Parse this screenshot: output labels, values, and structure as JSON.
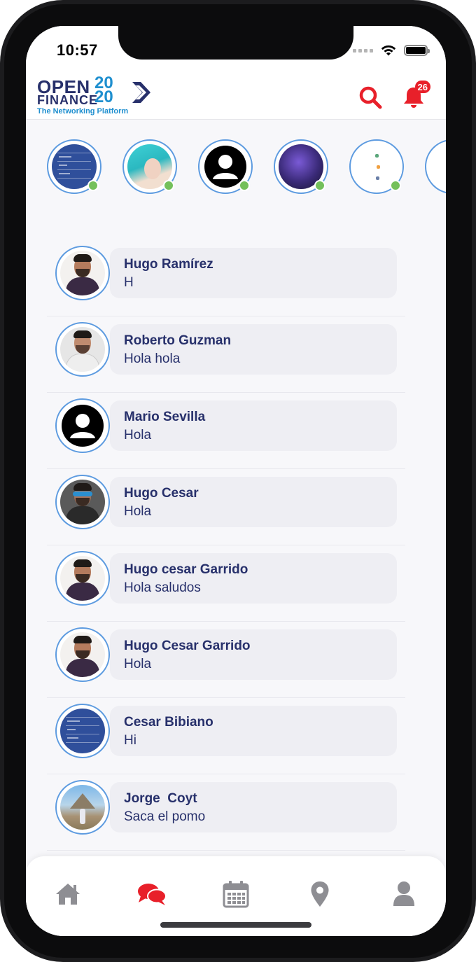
{
  "status_bar": {
    "time": "10:57"
  },
  "header": {
    "logo": {
      "line1": "OPEN",
      "line2": "FINANCE",
      "year_top": "20",
      "year_bottom": "20",
      "tagline": "The Networking Platform"
    },
    "search_icon": "search-icon",
    "bell_icon": "bell-icon",
    "notification_count": "26",
    "accent_color": "#e8202a"
  },
  "stories": [
    {
      "avatar": "blue-screen",
      "online": true
    },
    {
      "avatar": "teal-hair",
      "online": true
    },
    {
      "avatar": "default-user",
      "online": true
    },
    {
      "avatar": "purple-portrait",
      "online": true
    },
    {
      "avatar": "white-icons",
      "online": true
    },
    {
      "avatar": "partial",
      "online": false
    }
  ],
  "chats": [
    {
      "name": "Hugo Ramírez",
      "message": "H",
      "avatar": "man-beard"
    },
    {
      "name": "Roberto Guzman",
      "message": "Hola hola",
      "avatar": "man-white-shirt"
    },
    {
      "name": "Mario Sevilla",
      "message": "Hola",
      "avatar": "default-user"
    },
    {
      "name": "Hugo Cesar",
      "message": "Hola",
      "avatar": "man-sunglasses"
    },
    {
      "name": "Hugo cesar Garrido",
      "message": "Hola saludos",
      "avatar": "man-beard"
    },
    {
      "name": "Hugo Cesar Garrido",
      "message": "Hola",
      "avatar": "man-beard"
    },
    {
      "name": "Cesar Bibiano",
      "message": "Hi",
      "avatar": "blue-screen"
    },
    {
      "name": "Jorge  Coyt",
      "message": "Saca el pomo",
      "avatar": "pyramid-photo"
    }
  ],
  "bottom_nav": {
    "items": [
      {
        "icon": "home-icon",
        "active": false
      },
      {
        "icon": "chat-icon",
        "active": true
      },
      {
        "icon": "calendar-icon",
        "active": false
      },
      {
        "icon": "location-icon",
        "active": false
      },
      {
        "icon": "profile-icon",
        "active": false
      }
    ],
    "active_color": "#e8202a",
    "inactive_color": "#8e8e93"
  },
  "colors": {
    "name_text": "#27306b",
    "online": "#74c05b",
    "avatar_ring": "#5d9be0"
  }
}
